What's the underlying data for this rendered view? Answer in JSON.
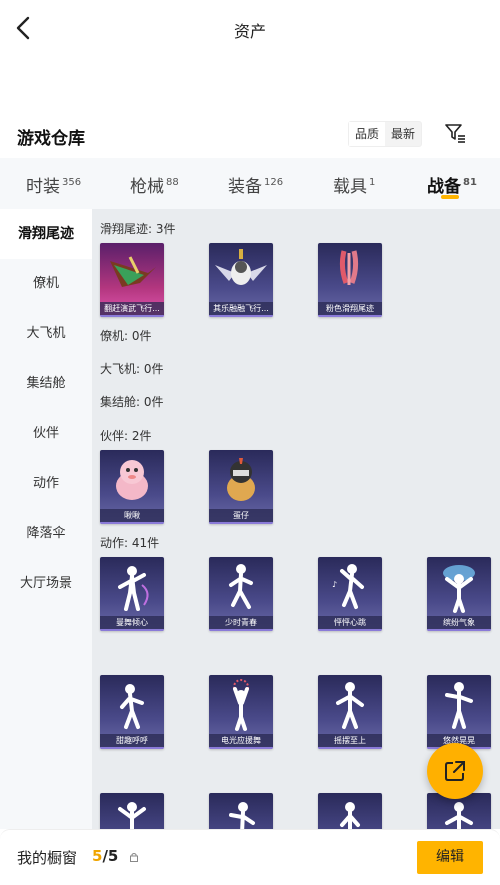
{
  "header": {
    "title": "资产"
  },
  "warehouse": {
    "title": "游戏仓库",
    "sort_options": [
      "品质",
      "最新"
    ],
    "sort_selected": "品质"
  },
  "tabs": [
    {
      "label": "时装",
      "count": "356"
    },
    {
      "label": "枪械",
      "count": "88"
    },
    {
      "label": "装备",
      "count": "126"
    },
    {
      "label": "载具",
      "count": "1"
    },
    {
      "label": "战备",
      "count": "81"
    }
  ],
  "active_tab": "战备",
  "sidebar": [
    {
      "label": "滑翔尾迹"
    },
    {
      "label": "僚机"
    },
    {
      "label": "大飞机"
    },
    {
      "label": "集结舱"
    },
    {
      "label": "伙伴"
    },
    {
      "label": "动作"
    },
    {
      "label": "降落伞"
    },
    {
      "label": "大厅场景"
    }
  ],
  "sections": {
    "glide_trail": {
      "header": "滑翔尾迹: 3件",
      "items": [
        "翻赶演武飞行...",
        "其乐融融飞行...",
        "粉色滑翔尾迹"
      ]
    },
    "wingman": {
      "header": "僚机: 0件"
    },
    "big_plane": {
      "header": "大飞机: 0件"
    },
    "assembly": {
      "header": "集结舱: 0件"
    },
    "partner": {
      "header": "伙伴: 2件",
      "items": [
        "啾啾",
        "蛋仔"
      ]
    },
    "emote": {
      "header": "动作: 41件",
      "items": [
        "曼舞倾心",
        "少时青春",
        "怦怦心跳",
        "缤纷气象",
        "甜趣呼呼",
        "电光应援舞",
        "摇摆至上",
        "悠然晃晃"
      ]
    }
  },
  "bottom": {
    "showcase_label": "我的橱窗",
    "count_current": "5",
    "count_sep": "/",
    "count_total": "5",
    "edit_label": "编辑"
  },
  "colors": {
    "accent": "#ffb400",
    "count": "#f0a500"
  },
  "icons": [
    "back-icon",
    "filter-icon",
    "share-icon",
    "lock-icon"
  ]
}
